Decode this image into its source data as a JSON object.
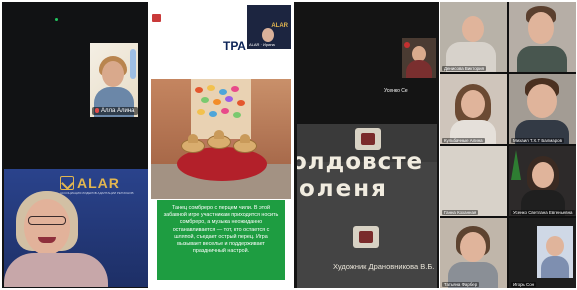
{
  "left_panel": {
    "self_view": {
      "name": "Алла Алина"
    },
    "speaker": {
      "brand": "ALAR",
      "brand_sub": "АССОЦИАЦИЯ ЛИДЕРОВ АДАПТАЦИИ РЕГИОНОВ"
    }
  },
  "slide": {
    "title_visible": "ТРА",
    "mini_tile": {
      "brand": "ALAR",
      "label": "ALAR · Ирина"
    },
    "caption": "Танец сомбреро с перцем чили. В этой забавной игре участникам приходится носить сомбреро, а музыка неожиданно останавливается — тот, кто остается с шляпой, съедает острый перец. Игра вызывает веселье и поддерживает праздничный настрой."
  },
  "book": {
    "title_line_1": "олдовсте",
    "title_line_2": "оленя",
    "author": "Художник Драновникова В.Б.",
    "participant_label": "Усенко Се"
  },
  "participants": [
    {
      "name": "Денисова Виктория"
    },
    {
      "name": ""
    },
    {
      "name": "Кульбачные Алина"
    },
    {
      "name": "Михаил Т.Х.Т Балмаров"
    },
    {
      "name": "Ганна Коханная"
    },
    {
      "name": "Усенко Светлана Евгеньевна"
    },
    {
      "name": "Татьяна Фарбер"
    },
    {
      "name": "Игорь Сон"
    }
  ],
  "colors": {
    "caption_bg": "#1e9d41",
    "brand_gold": "#e2b650",
    "slide_title": "#0d2457"
  }
}
